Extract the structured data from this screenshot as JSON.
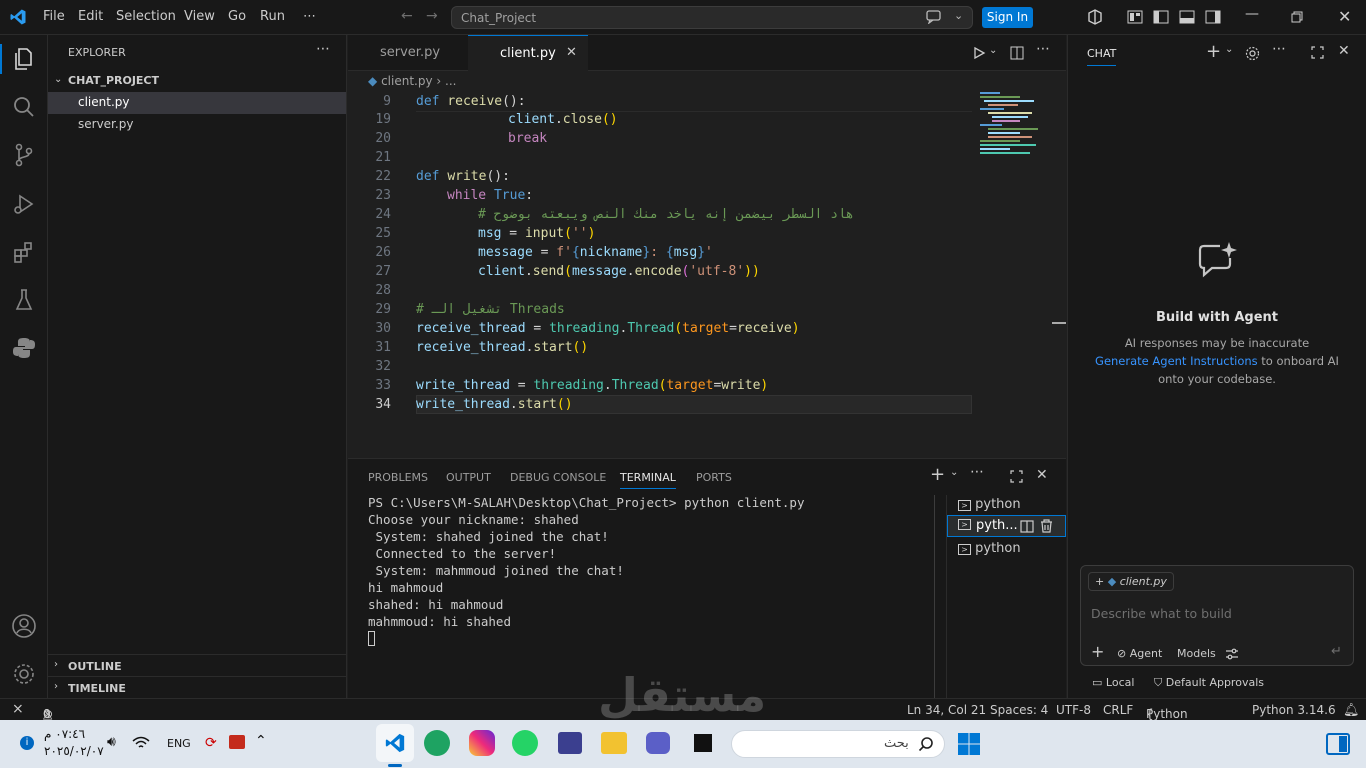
{
  "titlebar": {
    "menu": [
      "File",
      "Edit",
      "Selection",
      "View",
      "Go",
      "Run",
      "⋯"
    ],
    "search_text": "Chat_Project",
    "sign_in": "Sign In"
  },
  "sidebar": {
    "title": "EXPLORER",
    "project": "CHAT_PROJECT",
    "files": [
      "client.py",
      "server.py"
    ],
    "outline": "OUTLINE",
    "timeline": "TIMELINE"
  },
  "tabs": [
    "server.py",
    "client.py"
  ],
  "breadcrumb": "client.py",
  "breadcrumb_more": "...",
  "code": {
    "line_numbers": [
      "9",
      "19",
      "20",
      "21",
      "22",
      "23",
      "24",
      "25",
      "26",
      "27",
      "28",
      "29",
      "30",
      "31",
      "32",
      "33",
      "34"
    ],
    "l9": [
      "def",
      "receive",
      "():"
    ],
    "l19": [
      "client",
      ".",
      "close",
      "()"
    ],
    "l20": "break",
    "l22": [
      "def",
      "write",
      "():"
    ],
    "l23": [
      "while",
      "True",
      ":"
    ],
    "l24": "# هاد السطر بيضمن إنه ياخد منك النص ويبعته بوضوح",
    "l25": [
      "msg",
      " = ",
      "input",
      "(",
      "''",
      ")"
    ],
    "l26": [
      "message",
      " = ",
      "f'",
      "{",
      "nickname",
      "}",
      ": ",
      "{",
      "msg",
      "}",
      "'"
    ],
    "l27": [
      "client",
      ".",
      "send",
      "(",
      "message",
      ".",
      "encode",
      "(",
      "'utf-8'",
      "))"
    ],
    "l29": "# تشغيل الـ Threads",
    "l30": [
      "receive_thread",
      " = ",
      "threading",
      ".",
      "Thread",
      "(",
      "target",
      "=",
      "receive",
      ")"
    ],
    "l31": [
      "receive_thread",
      ".",
      "start",
      "()"
    ],
    "l33": [
      "write_thread",
      " = ",
      "threading",
      ".",
      "Thread",
      "(",
      "target",
      "=",
      "write",
      ")"
    ],
    "l34": [
      "write_thread",
      ".",
      "start",
      "()"
    ]
  },
  "panel": {
    "tabs": [
      "PROBLEMS",
      "OUTPUT",
      "DEBUG CONSOLE",
      "TERMINAL",
      "PORTS"
    ],
    "terminal_lines": [
      "PS C:\\Users\\M-SALAH\\Desktop\\Chat_Project> python client.py",
      "Choose your nickname: shahed",
      " System: shahed joined the chat!",
      " Connected to the server!",
      " System: mahmmoud joined the chat!",
      "hi mahmoud",
      "shahed: hi mahmoud",
      "mahmmoud: hi shahed"
    ],
    "terminals": [
      "python",
      "pyth...",
      "python"
    ]
  },
  "chat": {
    "title": "CHAT",
    "heading": "Build with Agent",
    "line1": "AI responses may be inaccurate",
    "link": "Generate Agent Instructions",
    "line2_rest": " to onboard AI",
    "line3": "onto your codebase.",
    "context_file": "client.py",
    "placeholder": "Describe what to build",
    "agent": "Agent",
    "models": "Models",
    "local": "Local",
    "approvals": "Default Approvals"
  },
  "statusbar": {
    "errors": "0",
    "warnings": "0",
    "position": "Ln 34, Col 21",
    "spaces": "Spaces: 4",
    "encoding": "UTF-8",
    "eol": "CRLF",
    "language": "Python",
    "interpreter": "Python 3.14.6"
  },
  "taskbar": {
    "time": "٠٧:٤٦ م",
    "date": "٢٠٢٥/٠٢/٠٧",
    "lang": "ENG",
    "search": "بحث"
  },
  "watermark": "مستقل"
}
